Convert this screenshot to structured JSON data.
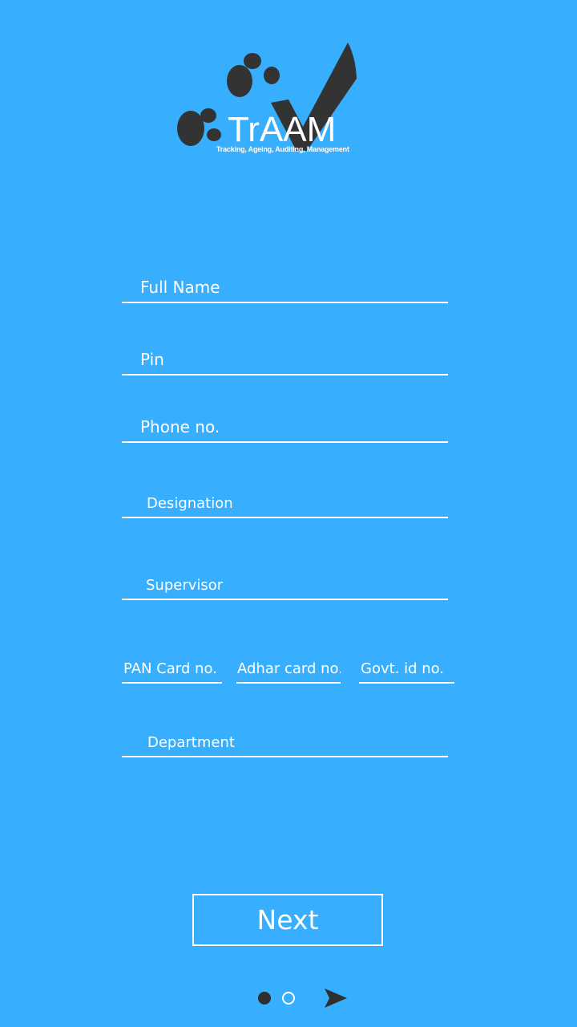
{
  "logo": {
    "wordmark": "TrAAM",
    "tagline": "Tracking, Ageing, Auditing, Management"
  },
  "form": {
    "full_name": {
      "placeholder": "Full Name",
      "value": ""
    },
    "pin": {
      "placeholder": "Pin",
      "value": ""
    },
    "phone": {
      "placeholder": "Phone no.",
      "value": ""
    },
    "designation": {
      "placeholder": "Designation",
      "value": ""
    },
    "supervisor": {
      "placeholder": "Supervisor",
      "value": ""
    },
    "pan": {
      "placeholder": "PAN Card no.",
      "value": ""
    },
    "adhar": {
      "placeholder": "Adhar card no.",
      "value": ""
    },
    "govt_id": {
      "placeholder": "Govt. id no.",
      "value": ""
    },
    "department": {
      "placeholder": "Department",
      "value": ""
    }
  },
  "next_button": {
    "label": "Next"
  },
  "pager": {
    "current_page": 1,
    "total_pages": 2
  },
  "colors": {
    "background": "#38aefe",
    "text": "#ffffff",
    "logo_dark": "#333333"
  }
}
